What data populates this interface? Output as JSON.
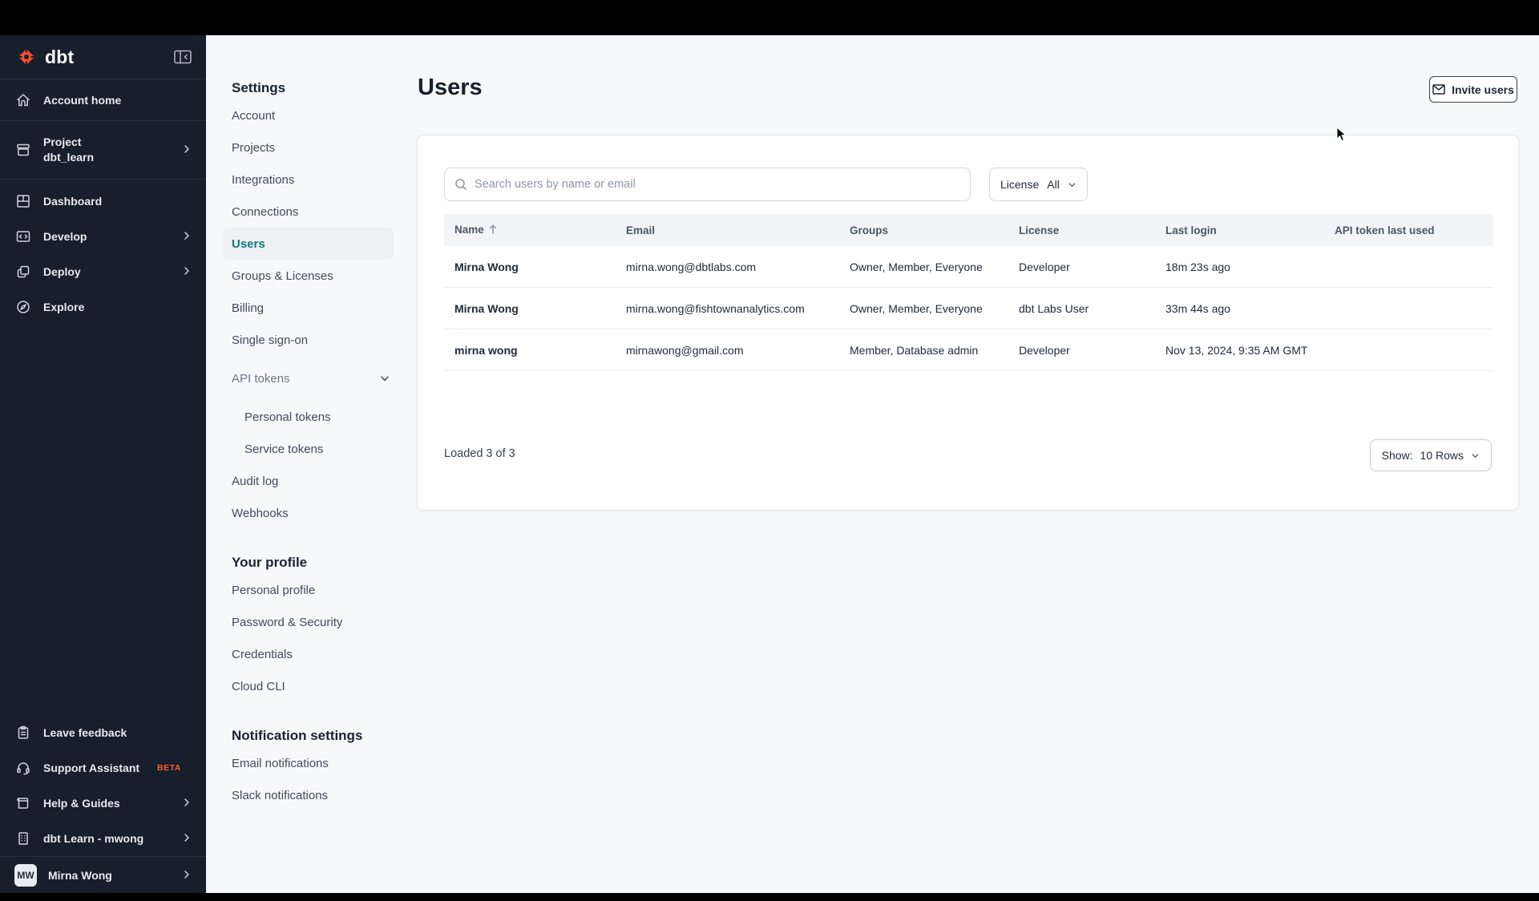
{
  "sidebar": {
    "logo_text": "dbt",
    "items": [
      {
        "label": "Account home"
      },
      {
        "label": "Project",
        "sublabel": "dbt_learn"
      },
      {
        "label": "Dashboard"
      },
      {
        "label": "Develop"
      },
      {
        "label": "Deploy"
      },
      {
        "label": "Explore"
      }
    ],
    "footer_items": [
      {
        "label": "Leave feedback"
      },
      {
        "label": "Support Assistant",
        "badge": "BETA"
      },
      {
        "label": "Help & Guides"
      },
      {
        "label": "dbt Learn - mwong"
      }
    ],
    "user": {
      "initials": "MW",
      "name": "Mirna Wong"
    }
  },
  "settings_nav": {
    "heading": "Settings",
    "items": [
      {
        "label": "Account"
      },
      {
        "label": "Projects"
      },
      {
        "label": "Integrations"
      },
      {
        "label": "Connections"
      },
      {
        "label": "Users"
      },
      {
        "label": "Groups & Licenses"
      },
      {
        "label": "Billing"
      },
      {
        "label": "Single sign-on"
      },
      {
        "label": "API tokens"
      },
      {
        "label": "Personal tokens"
      },
      {
        "label": "Service tokens"
      },
      {
        "label": "Audit log"
      },
      {
        "label": "Webhooks"
      }
    ],
    "profile_heading": "Your profile",
    "profile_items": [
      {
        "label": "Personal profile"
      },
      {
        "label": "Password & Security"
      },
      {
        "label": "Credentials"
      },
      {
        "label": "Cloud CLI"
      }
    ],
    "notifications_heading": "Notification settings",
    "notification_items": [
      {
        "label": "Email notifications"
      },
      {
        "label": "Slack notifications"
      }
    ]
  },
  "main": {
    "title": "Users",
    "invite_button_label": "Invite users",
    "search_placeholder": "Search users by name or email",
    "license_filter": {
      "label": "License",
      "value": "All"
    },
    "table": {
      "columns": [
        "Name",
        "Email",
        "Groups",
        "License",
        "Last login",
        "API token last used"
      ],
      "rows": [
        {
          "name": "Mirna Wong",
          "email": "mirna.wong@dbtlabs.com",
          "groups": "Owner, Member, Everyone",
          "license": "Developer",
          "last_login": "18m 23s ago",
          "api_token_last_used": ""
        },
        {
          "name": "Mirna Wong",
          "email": "mirna.wong@fishtownanalytics.com",
          "groups": "Owner, Member, Everyone",
          "license": "dbt Labs User",
          "last_login": "33m 44s ago",
          "api_token_last_used": ""
        },
        {
          "name": "mirna wong",
          "email": "mirnawong@gmail.com",
          "groups": "Member, Database admin",
          "license": "Developer",
          "last_login": "Nov 13, 2024, 9:35 AM GMT",
          "api_token_last_used": ""
        }
      ]
    },
    "footer": {
      "loaded_text": "Loaded 3 of 3",
      "show_label": "Show:",
      "show_value": "10 Rows"
    }
  },
  "colors": {
    "sidebar_bg": "#171e2c",
    "brand_orange": "#ff5030",
    "active_teal": "#127b80",
    "topbar": "#000000",
    "main_bg": "#f7f8fa"
  }
}
